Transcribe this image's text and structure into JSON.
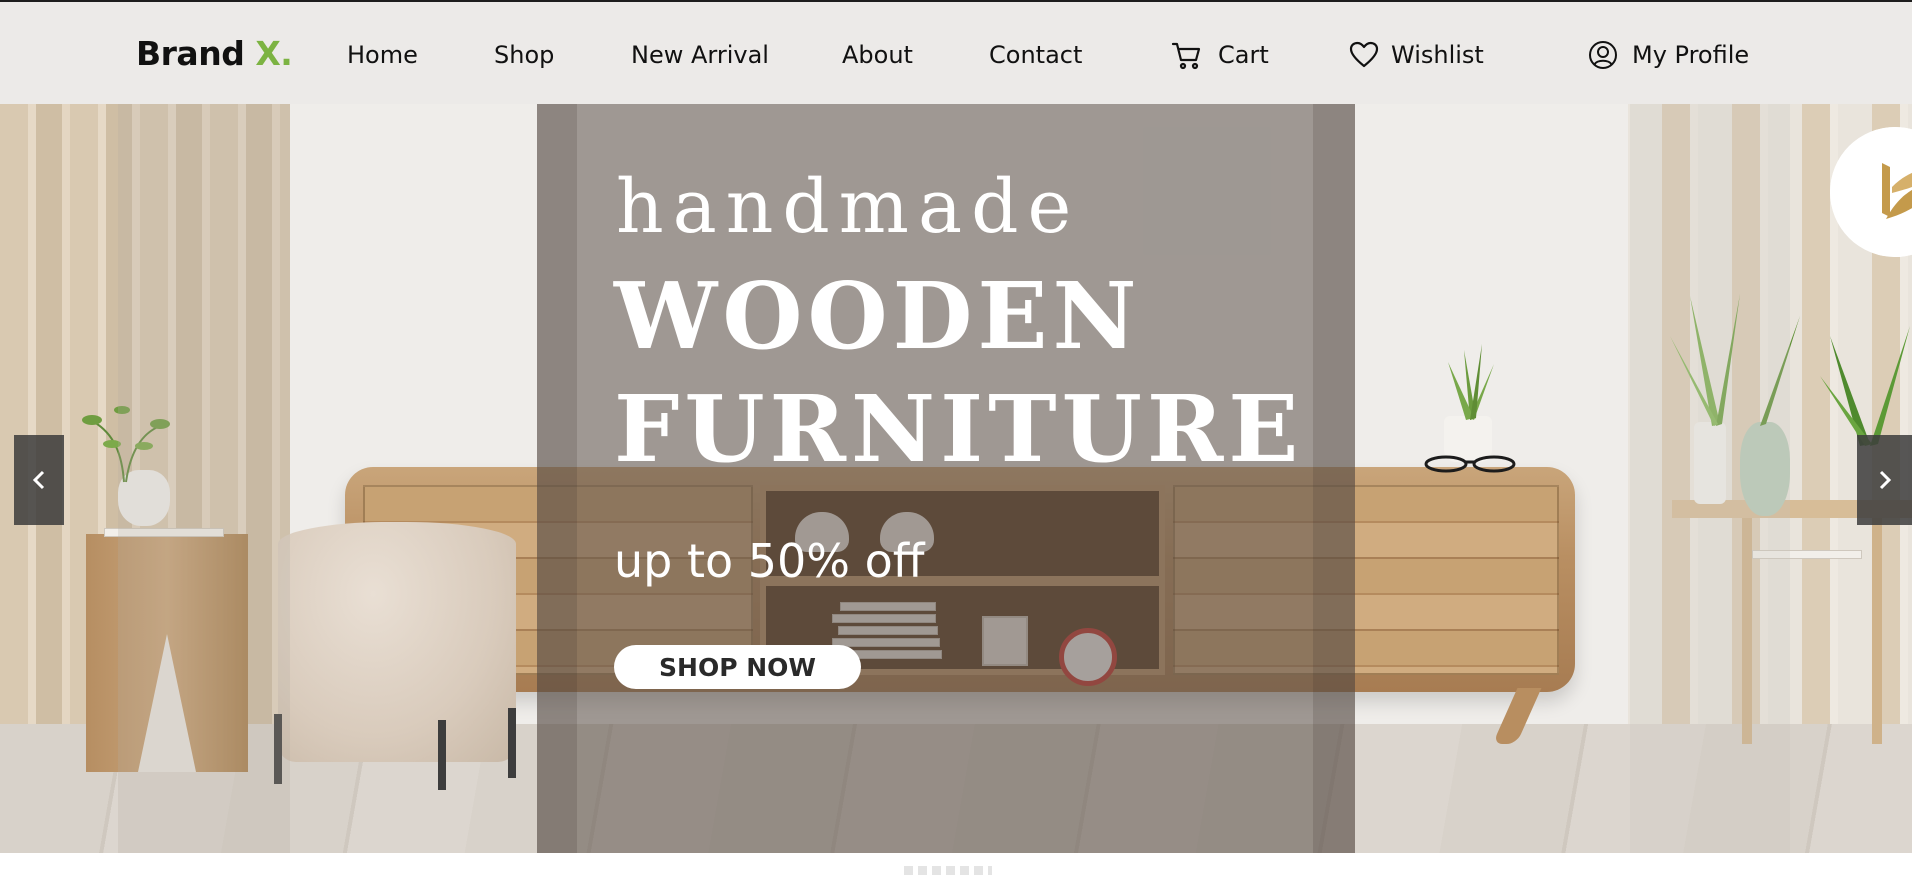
{
  "header": {
    "brand": {
      "name": "Brand",
      "accent": "X."
    },
    "nav": [
      {
        "label": "Home"
      },
      {
        "label": "Shop"
      },
      {
        "label": "New Arrival"
      },
      {
        "label": "About"
      },
      {
        "label": "Contact"
      }
    ],
    "cart": {
      "label": "Cart",
      "icon": "cart-icon"
    },
    "wishlist": {
      "label": "Wishlist",
      "icon": "heart-icon"
    },
    "profile": {
      "label": "My Profile",
      "icon": "user-circle-icon"
    }
  },
  "hero": {
    "kicker": "handmade",
    "title_line1": "WOODEN",
    "title_line2": "FURNITURE",
    "subtitle": "up to 50% off",
    "cta_label": "SHOP NOW",
    "prev_icon": "chevron-left-icon",
    "next_icon": "chevron-right-icon"
  },
  "colors": {
    "header_bg": "#eceae8",
    "brand_accent": "#7cb342",
    "overlay": "#5c524b",
    "button_bg": "#ffffff",
    "arrow_bg": "#3c3c3c"
  }
}
